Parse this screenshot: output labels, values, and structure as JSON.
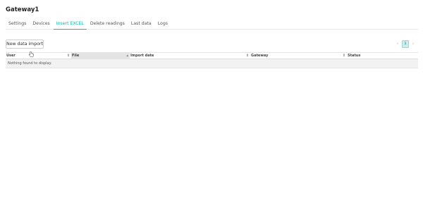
{
  "page": {
    "title": "Gateway1"
  },
  "tabs": [
    {
      "label": "Settings",
      "active": false
    },
    {
      "label": "Devices",
      "active": false
    },
    {
      "label": "Insert EXCEL",
      "active": true
    },
    {
      "label": "Delete readings",
      "active": false
    },
    {
      "label": "Last data",
      "active": false
    },
    {
      "label": "Logs",
      "active": false
    }
  ],
  "toolbar": {
    "new_import_label": "New data import"
  },
  "pagination": {
    "current_page": "1",
    "prev_icon": "chevron-left-icon",
    "next_icon": "chevron-right-icon"
  },
  "table": {
    "columns": [
      {
        "label": "User",
        "sort_indicator": "both"
      },
      {
        "label": "File",
        "sort_indicator": "ascending",
        "sorted": true
      },
      {
        "label": "Import date",
        "sort_indicator": "both"
      },
      {
        "label": "Gateway",
        "sort_indicator": "both"
      },
      {
        "label": "Status",
        "sort_indicator": "none"
      }
    ],
    "empty_message": "Nothing found to display."
  },
  "colors": {
    "accent": "#1bb1ab",
    "sorted_header": "#e4e4e4",
    "empty_row": "#f2f2f2"
  }
}
